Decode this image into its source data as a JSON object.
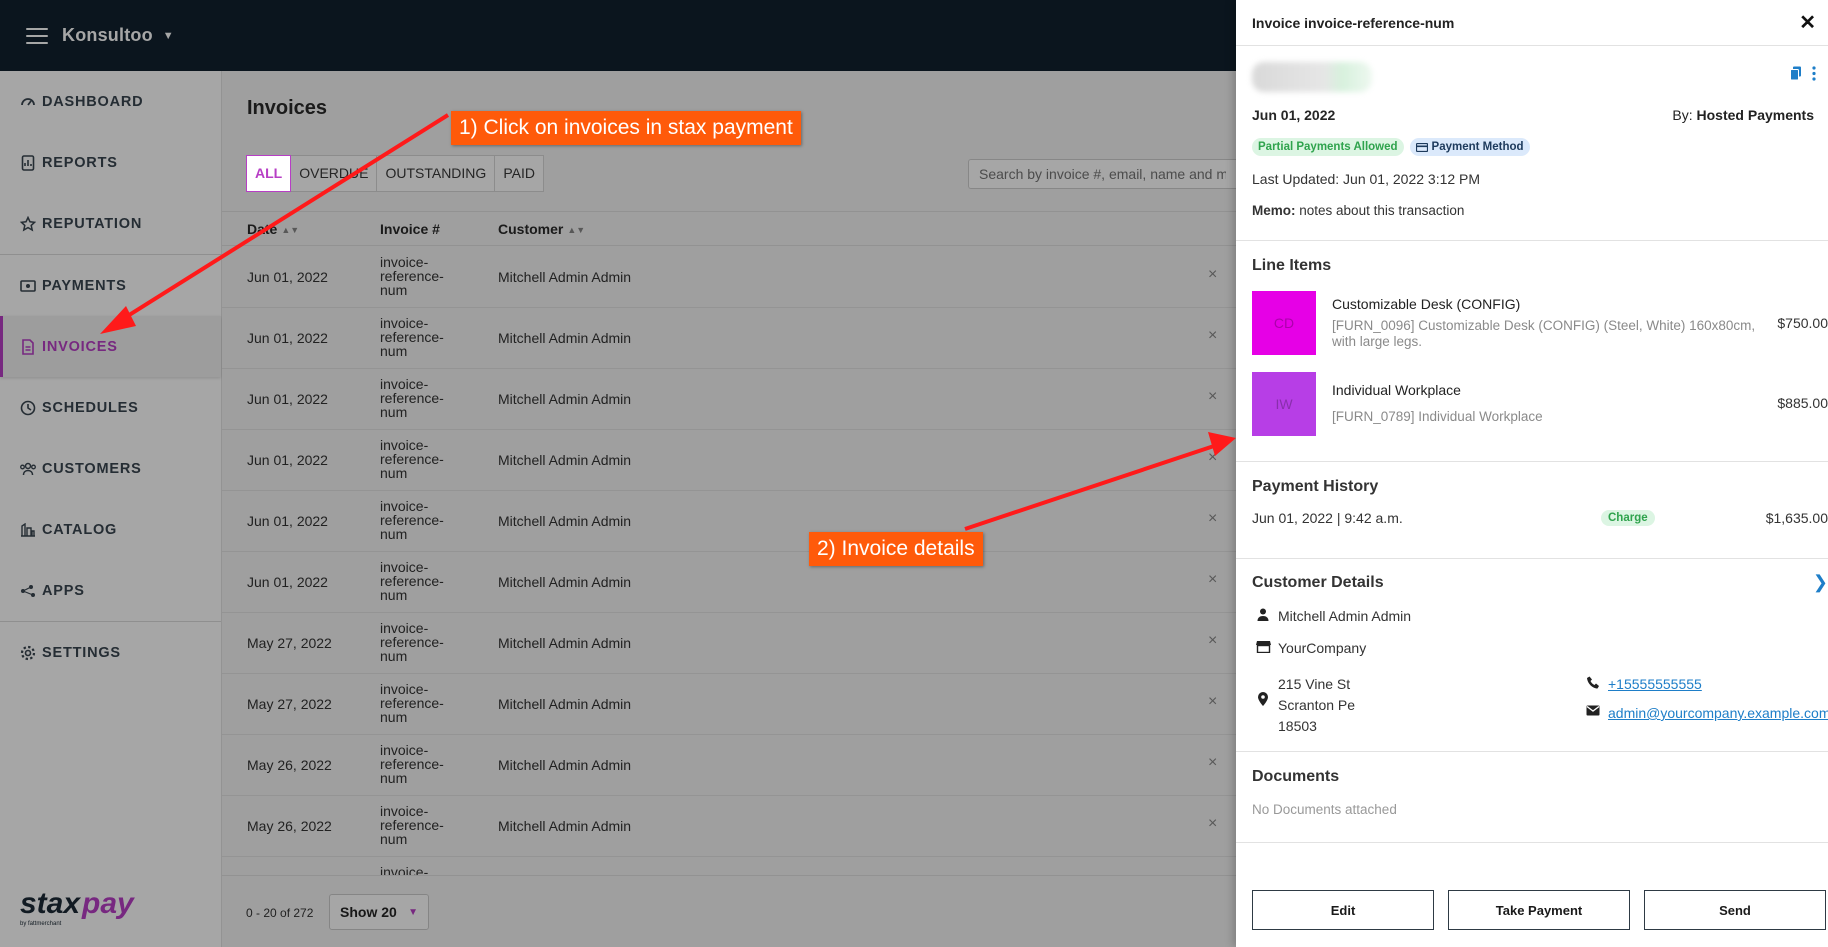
{
  "app": {
    "brand": "Konsultoo"
  },
  "sidebar": {
    "items": [
      {
        "label": "DASHBOARD",
        "icon": "dashboard-icon"
      },
      {
        "label": "REPORTS",
        "icon": "report-icon"
      },
      {
        "label": "REPUTATION",
        "icon": "star-icon"
      },
      {
        "label": "PAYMENTS",
        "icon": "money-icon"
      },
      {
        "label": "INVOICES",
        "icon": "invoice-icon",
        "active": true
      },
      {
        "label": "SCHEDULES",
        "icon": "clock-icon"
      },
      {
        "label": "CUSTOMERS",
        "icon": "users-icon"
      },
      {
        "label": "CATALOG",
        "icon": "catalog-icon"
      },
      {
        "label": "APPS",
        "icon": "apps-icon"
      },
      {
        "label": "SETTINGS",
        "icon": "gear-icon"
      }
    ],
    "logo_text": "staxpay",
    "logo_sub": "by fattmerchant"
  },
  "main": {
    "title": "Invoices",
    "filters": [
      "ALL",
      "OVERDUE",
      "OUTSTANDING",
      "PAID"
    ],
    "search_placeholder": "Search by invoice #, email, name and more",
    "columns": {
      "date": "Date",
      "invoice": "Invoice #",
      "customer": "Customer"
    },
    "rows": [
      {
        "date": "Jun 01, 2022",
        "invoice": "invoice-reference-num",
        "customer": "Mitchell Admin Admin"
      },
      {
        "date": "Jun 01, 2022",
        "invoice": "invoice-reference-num",
        "customer": "Mitchell Admin Admin"
      },
      {
        "date": "Jun 01, 2022",
        "invoice": "invoice-reference-num",
        "customer": "Mitchell Admin Admin"
      },
      {
        "date": "Jun 01, 2022",
        "invoice": "invoice-reference-num",
        "customer": "Mitchell Admin Admin"
      },
      {
        "date": "Jun 01, 2022",
        "invoice": "invoice-reference-num",
        "customer": "Mitchell Admin Admin"
      },
      {
        "date": "Jun 01, 2022",
        "invoice": "invoice-reference-num",
        "customer": "Mitchell Admin Admin"
      },
      {
        "date": "May 27, 2022",
        "invoice": "invoice-reference-num",
        "customer": "Mitchell Admin Admin"
      },
      {
        "date": "May 27, 2022",
        "invoice": "invoice-reference-num",
        "customer": "Mitchell Admin Admin"
      },
      {
        "date": "May 26, 2022",
        "invoice": "invoice-reference-num",
        "customer": "Mitchell Admin Admin"
      },
      {
        "date": "May 26, 2022",
        "invoice": "invoice-reference-num",
        "customer": "Mitchell Admin Admin"
      },
      {
        "date": "",
        "invoice": "invoice-",
        "customer": ""
      }
    ],
    "row_close": "×",
    "pager": "0 - 20 of 272",
    "show_label": "Show 20"
  },
  "drawer": {
    "title": "Invoice invoice-reference-num",
    "close": "✕",
    "date": "Jun 01, 2022",
    "by_label": "By:",
    "by_value": "Hosted Payments",
    "badge_partial": "Partial Payments Allowed",
    "badge_method": "Payment Method",
    "last_updated": "Last Updated: Jun 01, 2022 3:12 PM",
    "memo_label": "Memo:",
    "memo_value": "notes about this transaction",
    "line_items_title": "Line Items",
    "line_items": [
      {
        "initials": "CD",
        "name": "Customizable Desk (CONFIG)",
        "desc": "[FURN_0096] Customizable Desk (CONFIG) (Steel, White) 160x80cm, with large legs.",
        "price": "$750.00",
        "color": "#e600e6"
      },
      {
        "initials": "IW",
        "name": "Individual Workplace",
        "desc": "[FURN_0789] Individual Workplace",
        "price": "$885.00",
        "color": "#b73ee6"
      }
    ],
    "payment_history_title": "Payment History",
    "payment": {
      "date": "Jun 01, 2022 | 9:42 a.m.",
      "type": "Charge",
      "amount": "$1,635.00"
    },
    "customer_title": "Customer Details",
    "customer": {
      "name": "Mitchell Admin Admin",
      "company": "YourCompany",
      "address1": "215 Vine St",
      "address2": "Scranton Pe",
      "address3": "18503",
      "phone": "+15555555555",
      "email": "admin@yourcompany.example.com"
    },
    "documents_title": "Documents",
    "documents_empty": "No Documents attached",
    "buttons": {
      "edit": "Edit",
      "take_payment": "Take Payment",
      "send": "Send"
    }
  },
  "annotations": {
    "step1": "1) Click on invoices in stax payment",
    "step2": "2) Invoice details"
  },
  "colors": {
    "brand": "#b73ec5",
    "topbar": "#11212f",
    "callout": "#ff5a0a",
    "arrow": "#ff1a1a",
    "link": "#1e7ec8"
  }
}
